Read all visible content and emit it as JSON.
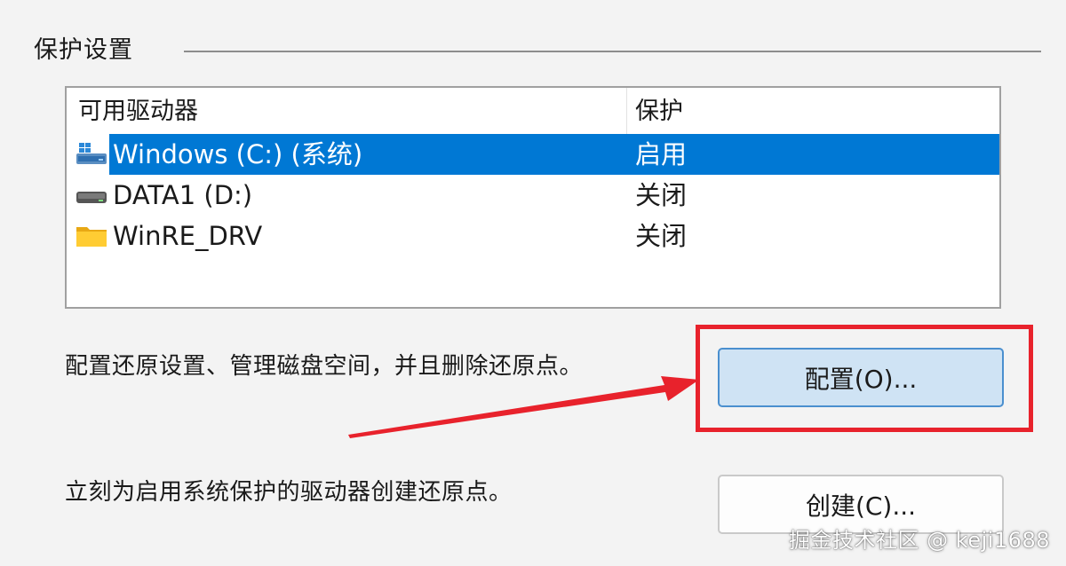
{
  "group": {
    "title": "保护设置"
  },
  "drive_list": {
    "columns": {
      "name": "可用驱动器",
      "protection": "保护"
    },
    "rows": [
      {
        "name": "Windows (C:) (系统)",
        "protection": "启用",
        "icon": "system-drive-icon",
        "selected": true
      },
      {
        "name": "DATA1 (D:)",
        "protection": "关闭",
        "icon": "hard-drive-icon",
        "selected": false
      },
      {
        "name": "WinRE_DRV",
        "protection": "关闭",
        "icon": "folder-icon",
        "selected": false
      }
    ]
  },
  "configure": {
    "description": "配置还原设置、管理磁盘空间，并且删除还原点。",
    "button_label": "配置(O)..."
  },
  "create": {
    "description": "立刻为启用系统保护的驱动器创建还原点。",
    "button_label": "创建(C)..."
  },
  "watermark": "掘金技术社区 @ keji1688",
  "colors": {
    "selection": "#0078d4",
    "annotation_red": "#e8222c",
    "button_accent": "#cfe3f4"
  }
}
